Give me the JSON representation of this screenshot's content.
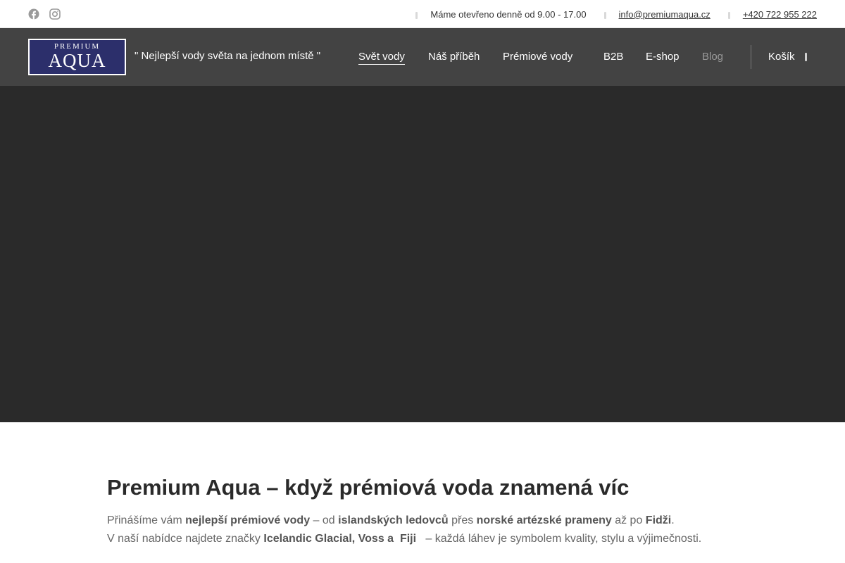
{
  "topbar": {
    "social": [
      {
        "icon": "facebook-icon"
      },
      {
        "icon": "instagram-icon"
      }
    ],
    "hours": "Máme otevřeno denně od 9.00 - 17.00",
    "email": "info@premiumaqua.cz",
    "phone": "+420 722 955 222"
  },
  "header": {
    "logo_top": "PREMIUM",
    "logo_main": "AQUA",
    "tagline": "\" Nejlepší vody světa na jednom místě \"",
    "nav": [
      {
        "label": "Svět vody"
      },
      {
        "label": "Náš příběh"
      },
      {
        "label": "Prémiové vody"
      },
      {
        "label": "B2B"
      },
      {
        "label": "E-shop"
      },
      {
        "label": "Blog"
      }
    ],
    "cart_label": "Košík"
  },
  "main": {
    "title": "Premium Aqua – když prémiová voda znamená víc",
    "p1": {
      "t1": "Přinášíme vám ",
      "b1": "nejlepší prémiové vody",
      "t2": " – od ",
      "b2": "islandských ledovců",
      "t3": " přes ",
      "b3": "norské artézské prameny",
      "t4": " až po ",
      "b4": "Fidži",
      "t5": "."
    },
    "p2": {
      "t1": "V naší nabídce najdete značky ",
      "b1": "Icelandic Glacial, Voss a  Fiji",
      "t2": "   – každá láhev je symbolem kvality, stylu a výjimečnosti."
    }
  },
  "colors": {
    "nav_bg": "#434343",
    "hero_bg": "#2a2a2a",
    "logo_bg": "#2c2f6b"
  }
}
